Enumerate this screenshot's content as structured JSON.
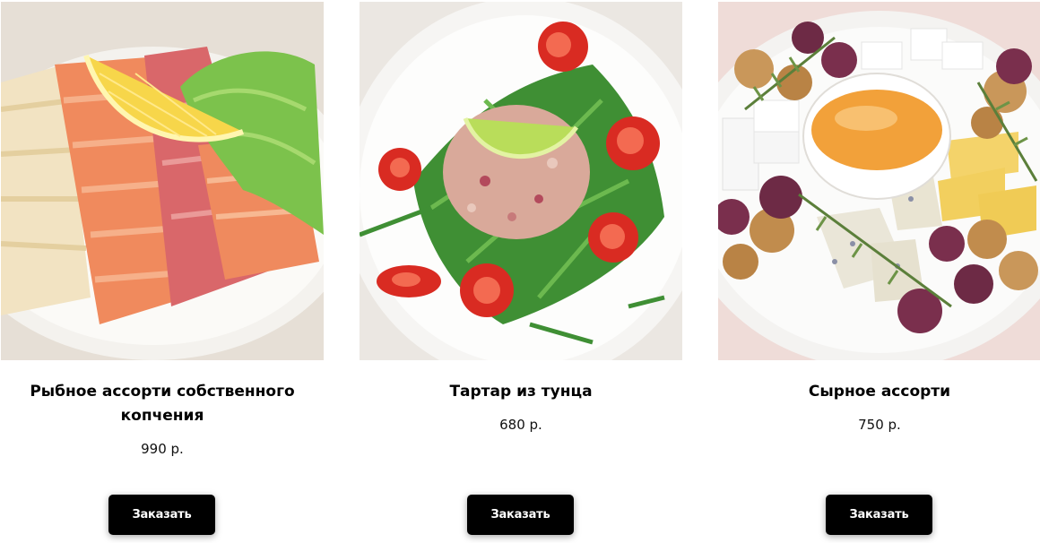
{
  "products": [
    {
      "title": "Рыбное ассорти собственного копчения",
      "price": "990 р.",
      "button": "Заказать"
    },
    {
      "title": "Тартар из тунца",
      "price": "680 р.",
      "button": "Заказать"
    },
    {
      "title": "Сырное ассорти",
      "price": "750 р.",
      "button": "Заказать"
    }
  ],
  "colors": {
    "button_bg": "#000000",
    "button_text": "#ffffff",
    "page_bg": "#ffffff"
  }
}
